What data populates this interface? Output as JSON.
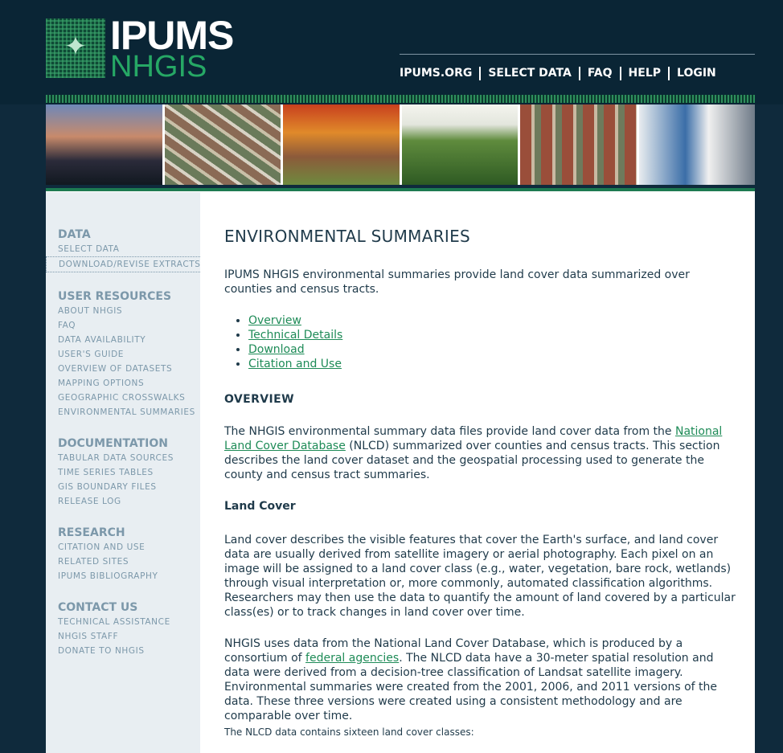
{
  "brand": {
    "name_top": "IPUMS",
    "name_bottom": "NHGIS"
  },
  "topnav": [
    "IPUMS.ORG",
    "SELECT DATA",
    "FAQ",
    "HELP",
    "LOGIN"
  ],
  "sidebar": [
    {
      "heading": "DATA",
      "items": [
        "SELECT DATA",
        "DOWNLOAD/REVISE EXTRACTS"
      ]
    },
    {
      "heading": "USER RESOURCES",
      "items": [
        "ABOUT NHGIS",
        "FAQ",
        "DATA AVAILABILITY",
        "USER'S GUIDE",
        "OVERVIEW OF DATASETS",
        "MAPPING OPTIONS",
        "GEOGRAPHIC CROSSWALKS",
        "ENVIRONMENTAL SUMMARIES"
      ]
    },
    {
      "heading": "DOCUMENTATION",
      "items": [
        "TABULAR DATA SOURCES",
        "TIME SERIES TABLES",
        "GIS BOUNDARY FILES",
        "RELEASE LOG"
      ]
    },
    {
      "heading": "RESEARCH",
      "items": [
        "CITATION AND USE",
        "RELATED SITES",
        "IPUMS BIBLIOGRAPHY"
      ]
    },
    {
      "heading": "CONTACT US",
      "items": [
        "TECHNICAL ASSISTANCE",
        "NHGIS STAFF",
        "DONATE TO NHGIS"
      ]
    }
  ],
  "main": {
    "title": "ENVIRONMENTAL SUMMARIES",
    "intro": "IPUMS NHGIS environmental summaries provide land cover data summarized over counties and census tracts.",
    "toc": [
      "Overview",
      "Technical Details",
      "Download",
      "Citation and Use"
    ],
    "overview_heading": "OVERVIEW",
    "overview_p_before": "The NHGIS environmental summary data files provide land cover data from the ",
    "overview_link": "National Land Cover Database",
    "overview_p_after": " (NLCD) summarized over counties and census tracts. This section describes the land cover dataset and the geospatial processing used to generate the county and census tract summaries.",
    "landcover_heading": "Land Cover",
    "landcover_p": "Land cover describes the visible features that cover the Earth's surface, and land cover data are usually derived from satellite imagery or aerial photography. Each pixel on an image will be assigned to a land cover class (e.g., water, vegetation, bare rock, wetlands) through visual interpretation or, more commonly, automated classification algorithms. Researchers may then use the data to quantify the amount of land covered by a particular class(es) or to track changes in land cover over time.",
    "nlcd_p_before": "NHGIS uses data from the National Land Cover Database, which is produced by a consortium of ",
    "nlcd_link": "federal agencies",
    "nlcd_p_after": ". The NLCD data have a 30-meter spatial resolution and data were derived from a decision-tree classification of Landsat satellite imagery. Environmental summaries were created from the 2001, 2006, and 2011 versions of the data. These three versions were created using a consistent methodology and are comparable over time.",
    "classes_line": "The NLCD data contains sixteen land cover classes:"
  }
}
